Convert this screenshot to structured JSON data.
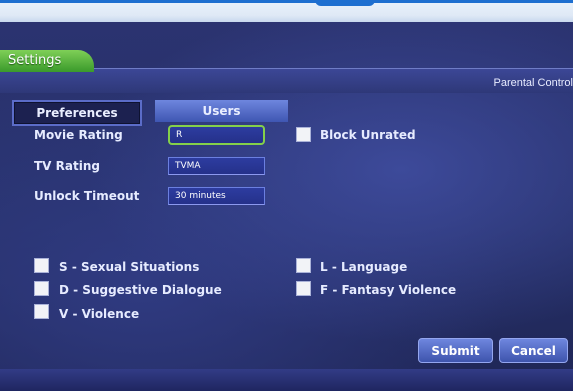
{
  "header": {
    "section_tab": "Settings",
    "page_title": "Parental Control"
  },
  "tabs": {
    "preferences": "Preferences",
    "users": "Users"
  },
  "form": {
    "movie_rating_label": "Movie Rating",
    "movie_rating_value": "R",
    "tv_rating_label": "TV Rating",
    "tv_rating_value": "TVMA",
    "unlock_timeout_label": "Unlock Timeout",
    "unlock_timeout_value": "30 minutes",
    "block_unrated_label": "Block Unrated"
  },
  "content_filters": {
    "sexual": "S - Sexual Situations",
    "dialogue": "D - Suggestive Dialogue",
    "violence": "V - Violence",
    "language": "L - Language",
    "fantasy": "F - Fantasy Violence"
  },
  "buttons": {
    "submit": "Submit",
    "cancel": "Cancel"
  },
  "colors": {
    "accent_green": "#7fcf57",
    "selected_field_border": "#84d04a",
    "tab_active": "#6e86de"
  }
}
